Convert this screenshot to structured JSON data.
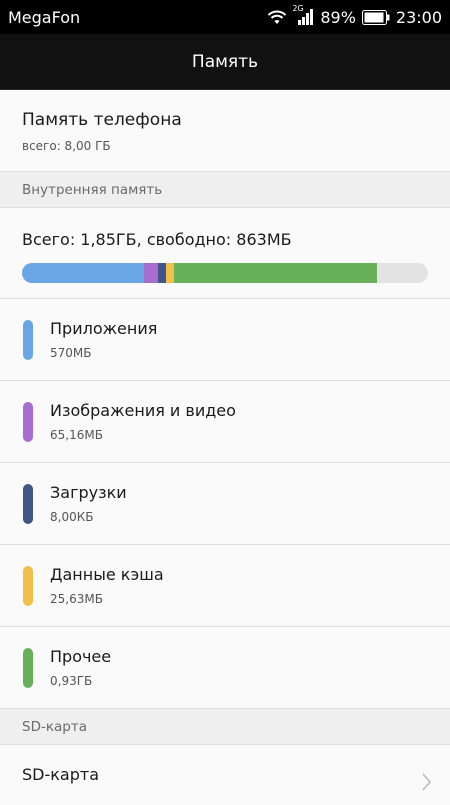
{
  "status": {
    "carrier": "MegaFon",
    "network": "2G",
    "battery": "89%",
    "time": "23:00"
  },
  "title": "Память",
  "phone_memory": {
    "title": "Память телефона",
    "subtitle": "всего: 8,00 ГБ"
  },
  "internal": {
    "header": "Внутренняя память",
    "summary": "Всего: 1,85ГБ, свободно: 863МБ"
  },
  "usage_bar": [
    {
      "fraction": 0.3,
      "color": "#6aa5e6"
    },
    {
      "fraction": 0.035,
      "color": "#a66cd0"
    },
    {
      "fraction": 0.02,
      "color": "#3f5687"
    },
    {
      "fraction": 0.02,
      "color": "#f0c04b"
    },
    {
      "fraction": 0.5,
      "color": "#68b05a"
    }
  ],
  "items": [
    {
      "label": "Приложения",
      "value": "570МБ",
      "color": "#6aa5e6"
    },
    {
      "label": "Изображения и видео",
      "value": "65,16МБ",
      "color": "#a66cd0"
    },
    {
      "label": "Загрузки",
      "value": "8,00КБ",
      "color": "#3f5687"
    },
    {
      "label": "Данные кэша",
      "value": "25,63МБ",
      "color": "#f0c04b"
    },
    {
      "label": "Прочее",
      "value": "0,93ГБ",
      "color": "#68b05a"
    }
  ],
  "sd": {
    "header": "SD-карта",
    "title": "SD-карта"
  }
}
